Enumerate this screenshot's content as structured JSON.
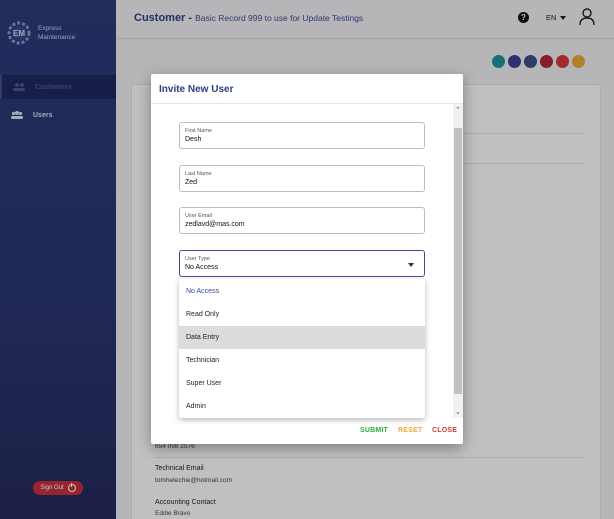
{
  "brand": {
    "line1": "Express",
    "line2": "Maintenance"
  },
  "sidebar": {
    "items": [
      {
        "label": "Customers"
      },
      {
        "label": "Users"
      }
    ],
    "signout_label": "Sign Out"
  },
  "header": {
    "title": "Customer -",
    "subtitle": "Basic Record 999 to use for Update Testings",
    "help": "?",
    "language": "EN"
  },
  "colors": {
    "sidebar": "#2c3a78",
    "accent": "#2f3c84",
    "actions": [
      "#1f8f9b",
      "#3a3f93",
      "#3e4a8a",
      "#b22834",
      "#d4373b",
      "#e3a633"
    ]
  },
  "background": {
    "phone": "654 098 2576",
    "tech_email_label": "Technical Email",
    "tech_email": "tomhetechie@hotmail.com",
    "accounting_label": "Accounting Contact",
    "accounting": "Eddie Bravo"
  },
  "modal": {
    "title": "Invite New User",
    "fields": {
      "first_name": {
        "label": "First Name",
        "value": "Desh"
      },
      "last_name": {
        "label": "Last Name",
        "value": "Zed"
      },
      "email": {
        "label": "User Email",
        "value": "zedlavd@mas.com"
      },
      "user_type": {
        "label": "User Type",
        "value": "No Access"
      }
    },
    "options": [
      "No Access",
      "Read Only",
      "Data Entry",
      "Technician",
      "Super User",
      "Admin"
    ],
    "buttons": {
      "submit": "SUBMIT",
      "reset": "RESET",
      "close": "CLOSE"
    }
  }
}
